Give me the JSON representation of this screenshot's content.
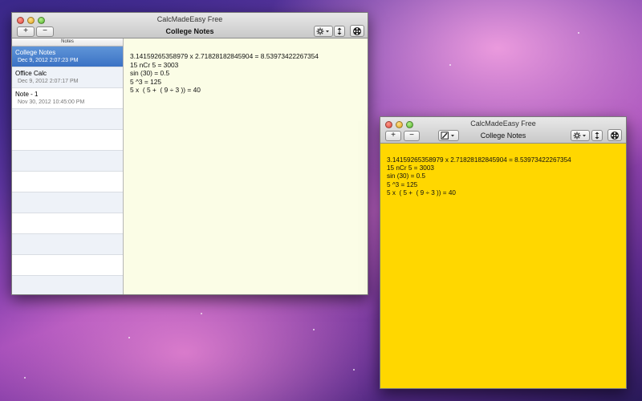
{
  "main_window": {
    "app_title": "CalcMadeEasy Free",
    "doc_title": "College Notes",
    "add_label": "+",
    "remove_label": "−",
    "notes_header": "Notes",
    "notes": [
      {
        "name": "College Notes",
        "date": "Dec 9, 2012 2:07:23 PM",
        "selected": true
      },
      {
        "name": "Office Calc",
        "date": "Dec 9, 2012 2:07:17 PM"
      },
      {
        "name": "Note - 1",
        "date": "Nov 30, 2012 10:45:00 PM"
      },
      {
        "name": "",
        "date": ""
      },
      {
        "name": "",
        "date": ""
      },
      {
        "name": "",
        "date": ""
      },
      {
        "name": "",
        "date": ""
      },
      {
        "name": "",
        "date": ""
      },
      {
        "name": "",
        "date": ""
      },
      {
        "name": "",
        "date": ""
      },
      {
        "name": "",
        "date": ""
      },
      {
        "name": "",
        "date": ""
      }
    ],
    "lines": [
      "3.14159265358979 x 2.71828182845904 = 8.53973422267354",
      "15 nCr 5 = 3003",
      "sin (30) = 0.5",
      "5 ^3 = 125",
      "5 x  ( 5 +  ( 9 ÷ 3 )) = 40"
    ]
  },
  "sticky_window": {
    "app_title": "CalcMadeEasy Free",
    "doc_title": "College Notes",
    "add_label": "+",
    "remove_label": "−",
    "background_color": "#ffd700",
    "lines": [
      "3.14159265358979 x 2.71828182845904 = 8.53973422267354",
      "15 nCr 5 = 3003",
      "sin (30) = 0.5",
      "5 ^3 = 125",
      "5 x  ( 5 +  ( 9 ÷ 3 )) = 40"
    ]
  },
  "icons": [
    "gear-icon",
    "resize-icon",
    "film-reel-icon",
    "edit-icon",
    "chevron-down-icon"
  ]
}
